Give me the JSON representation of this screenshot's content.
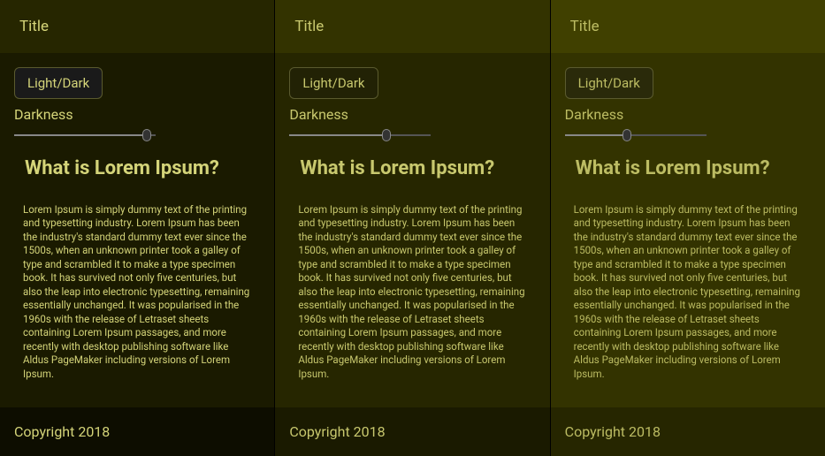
{
  "panels": [
    {
      "title": "Title",
      "toggle_label": "Light/Dark",
      "darkness_label": "Darkness",
      "heading": "What is Lorem Ipsum?",
      "body": "Lorem Ipsum is simply dummy text of the printing and typesetting industry. Lorem Ipsum has been the industry's standard dummy text ever since the 1500s, when an unknown printer took a galley of type and scrambled it to make a type specimen book. It has survived not only five centuries, but also the leap into electronic typesetting, remaining essentially unchanged. It was popularised in the 1960s with the release of Letraset sheets containing Lorem Ipsum passages, and more recently with desktop publishing software like Aldus PageMaker including versions of Lorem Ipsum.",
      "footer": "Copyright 2018"
    },
    {
      "title": "Title",
      "toggle_label": "Light/Dark",
      "darkness_label": "Darkness",
      "heading": "What is Lorem Ipsum?",
      "body": "Lorem Ipsum is simply dummy text of the printing and typesetting industry. Lorem Ipsum has been the industry's standard dummy text ever since the 1500s, when an unknown printer took a galley of type and scrambled it to make a type specimen book. It has survived not only five centuries, but also the leap into electronic typesetting, remaining essentially unchanged. It was popularised in the 1960s with the release of Letraset sheets containing Lorem Ipsum passages, and more recently with desktop publishing software like Aldus PageMaker including versions of Lorem Ipsum.",
      "footer": "Copyright 2018"
    },
    {
      "title": "Title",
      "toggle_label": "Light/Dark",
      "darkness_label": "Darkness",
      "heading": "What is Lorem Ipsum?",
      "body": "Lorem Ipsum is simply dummy text of the printing and typesetting industry. Lorem Ipsum has been the industry's standard dummy text ever since the 1500s, when an unknown printer took a galley of type and scrambled it to make a type specimen book. It has survived not only five centuries, but also the leap into electronic typesetting, remaining essentially unchanged. It was popularised in the 1960s with the release of Letraset sheets containing Lorem Ipsum passages, and more recently with desktop publishing software like Aldus PageMaker including versions of Lorem Ipsum.",
      "footer": "Copyright 2018"
    }
  ]
}
